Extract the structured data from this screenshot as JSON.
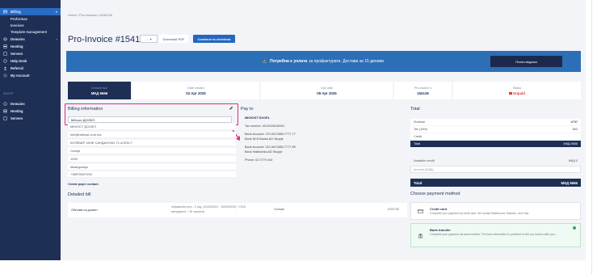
{
  "sidebar": {
    "items": [
      {
        "label": "Billing",
        "icon": "billing-icon"
      },
      {
        "label": "Proformas"
      },
      {
        "label": "Invoices"
      },
      {
        "label": "Template management"
      },
      {
        "label": "Domains",
        "icon": "globe-icon"
      },
      {
        "label": "Hosting",
        "icon": "server-icon"
      },
      {
        "label": "Servers",
        "icon": "server-icon"
      },
      {
        "label": "Help Desk",
        "icon": "help-icon"
      },
      {
        "label": "Referral",
        "icon": "user-icon"
      },
      {
        "label": "My Account",
        "icon": "settings-icon"
      }
    ],
    "shop_heading": "SHOP",
    "shop_items": [
      {
        "label": "Domains",
        "icon": "globe-icon"
      },
      {
        "label": "Hosting",
        "icon": "server-icon"
      },
      {
        "label": "Servers",
        "icon": "server-icon"
      }
    ]
  },
  "breadcrumb": "Home / Pro-invoices / #154126",
  "page_title": "Pro-Invoice #154126",
  "toolbar": {
    "more_label": "...",
    "pdf_label": "Download PDF",
    "checkout_label": "Continue to checkout"
  },
  "banner": {
    "strong": "Потребна е уплата",
    "text": "за профактурата. Достава за 15 денови.",
    "pay_button": "Плати веднаш"
  },
  "stats": [
    {
      "label": "Amount due",
      "value": "МКД 5666"
    },
    {
      "label": "Date created",
      "value": "02 Apr 2025"
    },
    {
      "label": "Due date",
      "value": "09 Apr 2025"
    },
    {
      "label": "Pro-invoice #",
      "value": "154126"
    },
    {
      "label": "Status",
      "value": "Unpaid"
    }
  ],
  "billing": {
    "heading": "Billing information",
    "name_value": "МКхост ДООЕЛ",
    "lines": [
      "МКХОСТ ДООЕЛ",
      "info@mkhost.com.mk",
      "БУЛЕВАР ЈАНЕ САНДАНСКИ 71-4/ЛОК.7",
      "Скопје",
      "1000",
      "Македонија",
      "+38975507030"
    ],
    "footer": "Create payer contact."
  },
  "pay_to": {
    "heading": "Pay to",
    "company": "MKHOST DOOEL",
    "lines": [
      "Tax number: 4012006160031",
      "Bank Account: 270-0617885-7777-77",
      "Bank NLB Banka AD Skopje",
      "Bank Account: 210-0617880-7777-89",
      "Bank Halkbanka AD Skopje",
      "Phone: 02 2779 444"
    ]
  },
  "totals": {
    "heading": "Total",
    "rows": [
      {
        "label": "Subtotal",
        "value": "4797"
      },
      {
        "label": "Tax (18%)",
        "value": "863"
      },
      {
        "label": "Credit",
        "value": ""
      }
    ],
    "total_row": {
      "label": "Total",
      "value": "МКД 5666"
    },
    "available_credit_label": "Available credit",
    "available_credit_value": "МКД 0",
    "amount_label": "Amount (МКД)",
    "final_label": "Total",
    "final_value": "МКД 5666"
  },
  "detailed_bill": {
    "heading": "Detailed bill",
    "item_name": "Обнова на домен",
    "item_desc_line1": "shipakonils.com - 3 год. (11/09/2022 - 10/09/2025) + DNS",
    "item_desc_line2": "менаџмент + ID заштита",
    "item_type": "Domain",
    "item_amount": "4797.00"
  },
  "payment_methods": {
    "heading": "Choose payment method",
    "options": [
      {
        "title": "Credit card",
        "desc": "Complete your payment by credit card. We accept Mastercard, Maestro, and Visa.",
        "icon": "credit-card-icon"
      },
      {
        "title": "Bank transfer",
        "desc": "Complete your payment via bank transfer. The bank information is provided on the pro-invoice after you...",
        "icon": "bank-icon"
      }
    ]
  },
  "colors": {
    "sidebar": "#1e2f55",
    "accent": "#2467c0",
    "banner": "#2c6fb6",
    "highlight": "#e32c7a",
    "unpaid": "#e53935",
    "success": "#2faa5a"
  }
}
